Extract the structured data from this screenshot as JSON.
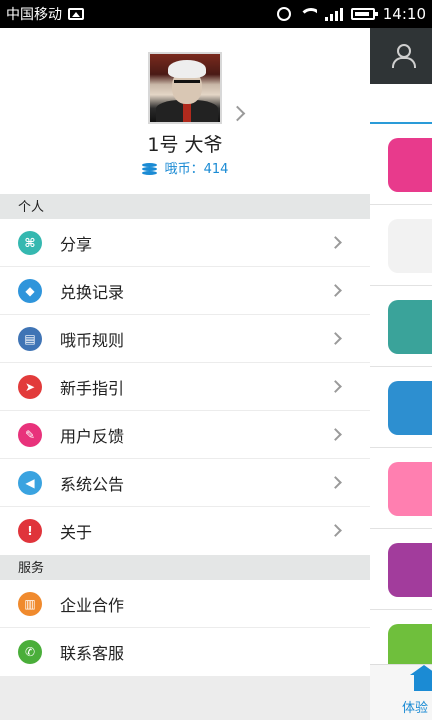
{
  "status_bar": {
    "carrier": "中国移动",
    "time": "14:10"
  },
  "profile": {
    "username": "1号 大爷",
    "coins_label": "哦币：414"
  },
  "sections": [
    {
      "header": "个人",
      "items": [
        {
          "label": "分享",
          "icon": "share-icon",
          "color": "#35b8b0"
        },
        {
          "label": "兑换记录",
          "icon": "tag-icon",
          "color": "#2f95db"
        },
        {
          "label": "哦币规则",
          "icon": "document-icon",
          "color": "#3f74b5"
        },
        {
          "label": "新手指引",
          "icon": "send-icon",
          "color": "#e23b3b"
        },
        {
          "label": "用户反馈",
          "icon": "edit-icon",
          "color": "#e8327b"
        },
        {
          "label": "系统公告",
          "icon": "speaker-icon",
          "color": "#3aa3e0"
        },
        {
          "label": "关于",
          "icon": "alert-icon",
          "color": "#e0343b"
        }
      ]
    },
    {
      "header": "服务",
      "items": [
        {
          "label": "企业合作",
          "icon": "bank-icon",
          "color": "#f08a2d"
        },
        {
          "label": "联系客服",
          "icon": "phone-icon",
          "color": "#4aae3a"
        }
      ]
    }
  ],
  "background_app": {
    "bottom_nav_label": "体验",
    "tile_colors": [
      "#e83a8c",
      "#f2f2f2",
      "#3aa39a",
      "#2d8fd0",
      "#ff7fb0",
      "#a23c9c",
      "#6fbf3c"
    ]
  }
}
